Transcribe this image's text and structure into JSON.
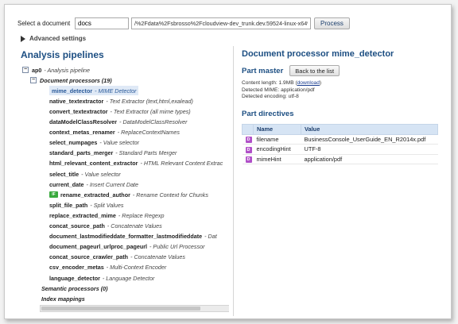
{
  "top": {
    "label": "Select a document",
    "doc_value": "docs",
    "path_value": "/%2Fdata%2Fsbrosso%2Fcloudview-dev_trunk.dev.59524-linux-x64%2",
    "process_label": "Process"
  },
  "advanced_label": "Advanced settings",
  "left": {
    "title": "Analysis pipelines",
    "ap0": {
      "name": "ap0",
      "desc": "- Analysis pipeline",
      "toggle": "−"
    },
    "doc_proc": {
      "name": "Document processors (19)",
      "toggle": "−"
    },
    "items": [
      {
        "name": "mime_detector",
        "desc": "- MIME Detector"
      },
      {
        "name": "native_textextractor",
        "desc": "- Text Extractor (text,html,exalead)"
      },
      {
        "name": "convert_textextractor",
        "desc": "- Text Extractor (all mime types)"
      },
      {
        "name": "dataModelClassResolver",
        "desc": "- DataModelClassResolver"
      },
      {
        "name": "context_metas_renamer",
        "desc": "- ReplaceContextNames"
      },
      {
        "name": "select_numpages",
        "desc": "- Value selector"
      },
      {
        "name": "standard_parts_merger",
        "desc": "- Standard Parts Merger"
      },
      {
        "name": "html_relevant_content_extractor",
        "desc": "- HTML Relevant Content Extrac"
      },
      {
        "name": "select_title",
        "desc": "- Value selector"
      },
      {
        "name": "current_date",
        "desc": "- Insert Current Date"
      },
      {
        "name": "rename_extracted_author",
        "desc": "- Rename Context for Chunks",
        "tag": "IF"
      },
      {
        "name": "split_file_path",
        "desc": "- Split Values"
      },
      {
        "name": "replace_extracted_mime",
        "desc": "- Replace Regexp"
      },
      {
        "name": "concat_source_path",
        "desc": "- Concatenate Values"
      },
      {
        "name": "document_lastmodifieddate_formatter_lastmodifieddate",
        "desc": "- Dat"
      },
      {
        "name": "document_pageurl_urlproc_pageurl",
        "desc": "- Public Url Processor"
      },
      {
        "name": "concat_source_crawler_path",
        "desc": "- Concatenate Values"
      },
      {
        "name": "csv_encoder_metas",
        "desc": "- Multi-Context Encoder"
      },
      {
        "name": "language_detector",
        "desc": "- Language Detector"
      }
    ],
    "semantic": "Semantic processors (0)",
    "index": "Index mappings"
  },
  "right": {
    "title": "Document processor mime_detector",
    "part_master": "Part master",
    "back_label": "Back to the list",
    "content_length_prefix": "Content length: 1.9MB (",
    "download_label": "download",
    "content_length_suffix": ")",
    "detected_mime": "Detected MIME: application/pdf",
    "detected_encoding": "Detected encoding: utf-8",
    "part_directives": "Part directives",
    "columns": [
      "Name",
      "Value"
    ],
    "rows": [
      {
        "icon": "D",
        "name": "filename",
        "value": "BusinessConsole_UserGuide_EN_R2014x.pdf"
      },
      {
        "icon": "D",
        "name": "encodingHint",
        "value": "UTF-8"
      },
      {
        "icon": "D",
        "name": "mimeHint",
        "value": "application/pdf"
      }
    ]
  },
  "colors": {
    "accent": "#1c4e82",
    "selected_bg": "#dfe9f6",
    "table_header": "#d6e4f4",
    "directive_icon": "#b050c8",
    "if_tag": "#3aaa3e"
  }
}
